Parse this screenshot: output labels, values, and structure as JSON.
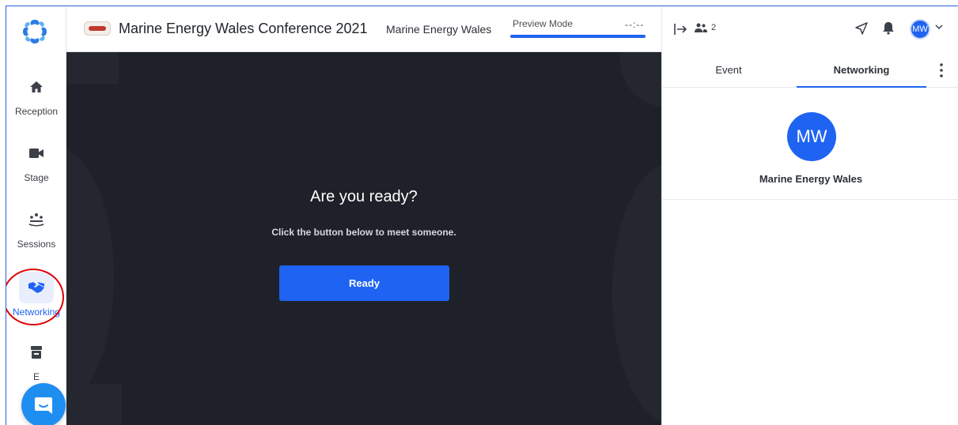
{
  "event": {
    "title": "Marine Energy Wales Conference 2021",
    "organizer": "Marine Energy Wales",
    "preview_label": "Preview Mode",
    "preview_time": "--:--"
  },
  "sidebar": {
    "items": [
      {
        "label": "Reception",
        "icon": "home-icon"
      },
      {
        "label": "Stage",
        "icon": "video-camera-icon"
      },
      {
        "label": "Sessions",
        "icon": "group-icon"
      },
      {
        "label": "Networking",
        "icon": "handshake-icon",
        "active": true
      },
      {
        "label": "E",
        "icon": "store-icon"
      }
    ]
  },
  "main": {
    "heading": "Are you ready?",
    "subtext": "Click the button below to meet someone.",
    "button_label": "Ready"
  },
  "right_panel": {
    "people_count": "2",
    "user_initials": "MW",
    "tabs": [
      {
        "label": "Event"
      },
      {
        "label": "Networking",
        "active": true
      }
    ],
    "profile": {
      "initials": "MW",
      "name": "Marine Energy Wales"
    }
  },
  "colors": {
    "accent": "#1f63f2",
    "stage_background": "#1e2129",
    "annotation": "#e00000"
  }
}
